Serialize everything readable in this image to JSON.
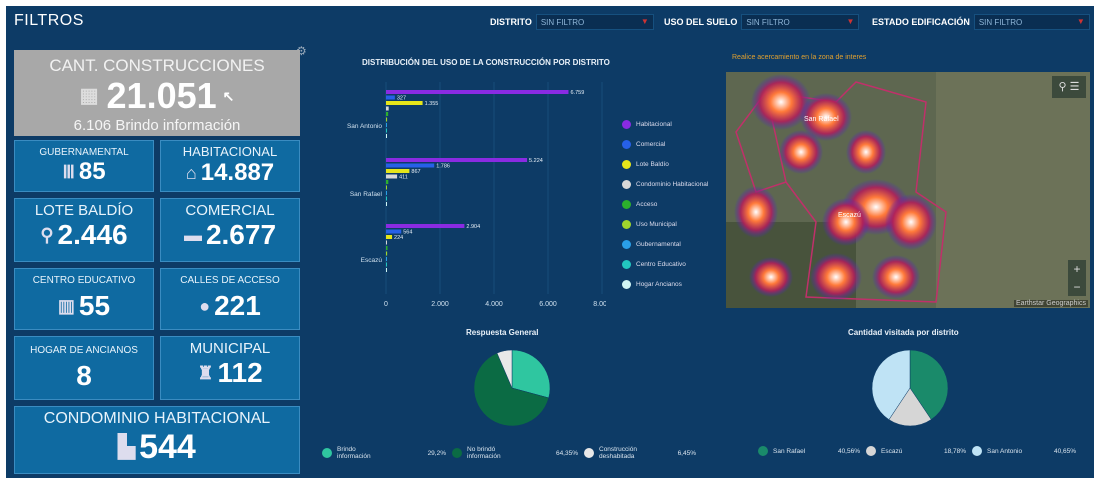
{
  "header": {
    "title": "FILTROS",
    "filters": [
      {
        "label": "DISTRITO",
        "value": "SIN FILTRO"
      },
      {
        "label": "USO DEL SUELO",
        "value": "SIN FILTRO"
      },
      {
        "label": "ESTADO EDIFICACIÓN",
        "value": "SIN FILTRO"
      }
    ]
  },
  "summary": {
    "label": "CANT. CONSTRUCCIONES",
    "value": "21.051",
    "sub": "6.106 Brindo información"
  },
  "cards": {
    "gubernamental": {
      "label": "GUBERNAMENTAL",
      "value": "85"
    },
    "habitacional": {
      "label": "HABITACIONAL",
      "value": "14.887"
    },
    "lote": {
      "label": "LOTE BALDÍO",
      "value": "2.446"
    },
    "comercial": {
      "label": "COMERCIAL",
      "value": "2.677"
    },
    "educativo": {
      "label": "CENTRO EDUCATIVO",
      "value": "55"
    },
    "calles": {
      "label": "CALLES DE ACCESO",
      "value": "221"
    },
    "hogar": {
      "label": "HOGAR DE ANCIANOS",
      "value": "8"
    },
    "municipal": {
      "label": "MUNICIPAL",
      "value": "112"
    },
    "condominio": {
      "label": "CONDOMINIO HABITACIONAL",
      "value": "544"
    }
  },
  "icons": {
    "gubernamental": "column-icon",
    "habitacional": "house-icon",
    "lote": "map-pin-icon",
    "comercial": "credit-card-icon",
    "educativo": "school-icon",
    "calles": "circle-icon",
    "municipal": "municipal-icon",
    "condominio": "building-icon"
  },
  "map": {
    "instruction": "Realice acercamiento en la zona de interes",
    "labels": [
      "San Rafael",
      "Escazú"
    ],
    "attribution": "Earthstar Geographics"
  },
  "chart_data": [
    {
      "type": "bar",
      "title": "DISTRIBUCIÓN DEL USO DE LA CONSTRUCCIÓN POR DISTRITO",
      "orientation": "horizontal",
      "categories": [
        "San Antonio",
        "San Rafael",
        "Escazú"
      ],
      "xlim": [
        0,
        8000
      ],
      "xticks": [
        "0",
        "2.000",
        "4.000",
        "6.000",
        "8.000"
      ],
      "series": [
        {
          "name": "Habitacional",
          "color": "#8a2be2",
          "values": [
            6759,
            5224,
            2904
          ]
        },
        {
          "name": "Comercial",
          "color": "#2660e8",
          "values": [
            327,
            1786,
            564
          ]
        },
        {
          "name": "Lote Baldío",
          "color": "#e6e61a",
          "values": [
            1355,
            867,
            224
          ]
        },
        {
          "name": "Condominio Habitacional",
          "color": "#d8d8d8",
          "values": [
            100,
            411,
            33
          ]
        },
        {
          "name": "Acceso",
          "color": "#2cb02c",
          "values": [
            80,
            86,
            55
          ]
        },
        {
          "name": "Uso Municipal",
          "color": "#a0d62c",
          "values": [
            40,
            30,
            42
          ]
        },
        {
          "name": "Gubernamental",
          "color": "#2a9fe8",
          "values": [
            30,
            26,
            29
          ]
        },
        {
          "name": "Centro Educativo",
          "color": "#22c7c0",
          "values": [
            22,
            17,
            16
          ]
        },
        {
          "name": "Hogar Ancianos",
          "color": "#d0f5f5",
          "values": [
            3,
            3,
            2
          ]
        }
      ],
      "data_labels": [
        [
          "6.759",
          "327",
          "1.355"
        ],
        [
          "5.224",
          "1.786",
          "867",
          "411"
        ],
        [
          "2.904",
          "564",
          "224"
        ]
      ]
    },
    {
      "type": "pie",
      "title": "Respuesta General",
      "slices": [
        {
          "name": "Brindo información",
          "value": 29.2,
          "label": "29,2%",
          "color": "#2fc6a0"
        },
        {
          "name": "No brindó información",
          "value": 64.35,
          "label": "64,35%",
          "color": "#0b6b44"
        },
        {
          "name": "Construcción deshabitada",
          "value": 6.45,
          "label": "6,45%",
          "color": "#e8e8e8"
        }
      ]
    },
    {
      "type": "pie",
      "title": "Cantidad visitada por distrito",
      "slices": [
        {
          "name": "San Rafael",
          "value": 40.56,
          "label": "40,56%",
          "color": "#1a8a6a"
        },
        {
          "name": "Escazú",
          "value": 18.78,
          "label": "18,78%",
          "color": "#d6d6d6"
        },
        {
          "name": "San Antonio",
          "value": 40.65,
          "label": "40,65%",
          "color": "#bfe3f5"
        }
      ]
    }
  ]
}
